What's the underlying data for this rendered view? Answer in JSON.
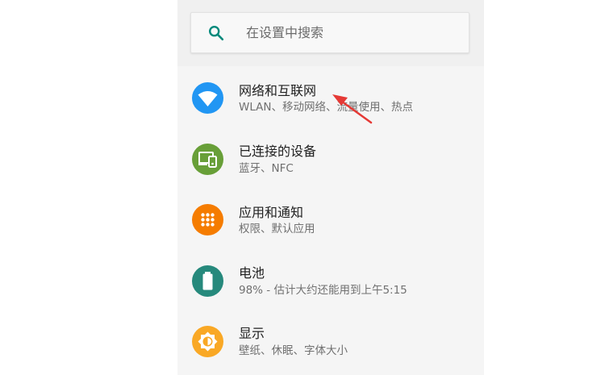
{
  "search": {
    "placeholder": "在设置中搜索"
  },
  "settings_items": [
    {
      "title": "网络和互联网",
      "subtitle": "WLAN、移动网络、流量使用、热点",
      "icon": "wifi-icon",
      "color": "#2196f3"
    },
    {
      "title": "已连接的设备",
      "subtitle": "蓝牙、NFC",
      "icon": "devices-icon",
      "color": "#689f38"
    },
    {
      "title": "应用和通知",
      "subtitle": "权限、默认应用",
      "icon": "apps-icon",
      "color": "#f57c00"
    },
    {
      "title": "电池",
      "subtitle": "98% - 估计大约还能用到上午5:15",
      "icon": "battery-icon",
      "color": "#26897c"
    },
    {
      "title": "显示",
      "subtitle": "壁纸、休眠、字体大小",
      "icon": "brightness-icon",
      "color": "#f9a825"
    }
  ],
  "colors": {
    "search_icon": "#00897b",
    "arrow": "#e53935"
  }
}
